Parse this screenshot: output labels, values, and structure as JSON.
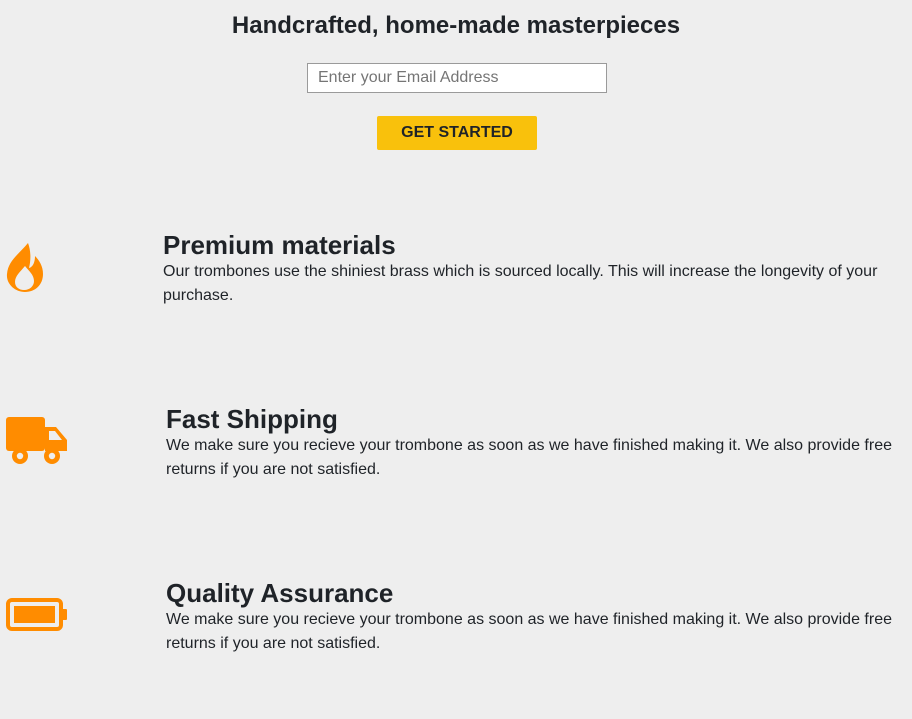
{
  "hero": {
    "title": "Handcrafted, home-made masterpieces",
    "email_placeholder": "Enter your Email Address",
    "email_value": "",
    "cta_label": "GET STARTED"
  },
  "colors": {
    "accent": "#f9c10c",
    "icon": "#ff8c00",
    "background": "#eeeeee",
    "text": "#1f2328"
  },
  "features": [
    {
      "icon": "fire-icon",
      "heading": "Premium materials",
      "body": "Our trombones use the shiniest brass which is sourced locally. This will increase the longevity of your purchase."
    },
    {
      "icon": "truck-icon",
      "heading": "Fast Shipping",
      "body": "We make sure you recieve your trombone as soon as we have finished making it. We also provide free returns if you are not satisfied."
    },
    {
      "icon": "battery-icon",
      "heading": "Quality Assurance",
      "body": "We make sure you recieve your trombone as soon as we have finished making it. We also provide free returns if you are not satisfied."
    }
  ]
}
